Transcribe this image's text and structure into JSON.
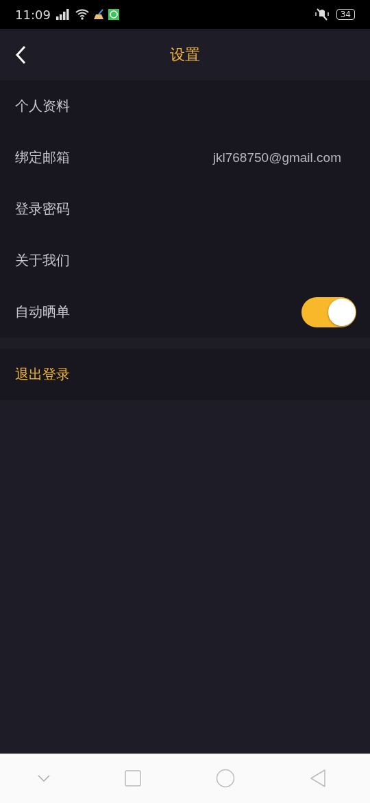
{
  "status_bar": {
    "time": "11:09",
    "battery": "34"
  },
  "header": {
    "title": "设置"
  },
  "settings": [
    {
      "kind": "link",
      "label": "个人资料"
    },
    {
      "kind": "value",
      "label": "绑定邮箱",
      "value": "jkl768750@gmail.com"
    },
    {
      "kind": "link",
      "label": "登录密码"
    },
    {
      "kind": "link",
      "label": "关于我们"
    },
    {
      "kind": "toggle",
      "label": "自动晒单",
      "on": true
    }
  ],
  "logout": {
    "label": "退出登录"
  }
}
